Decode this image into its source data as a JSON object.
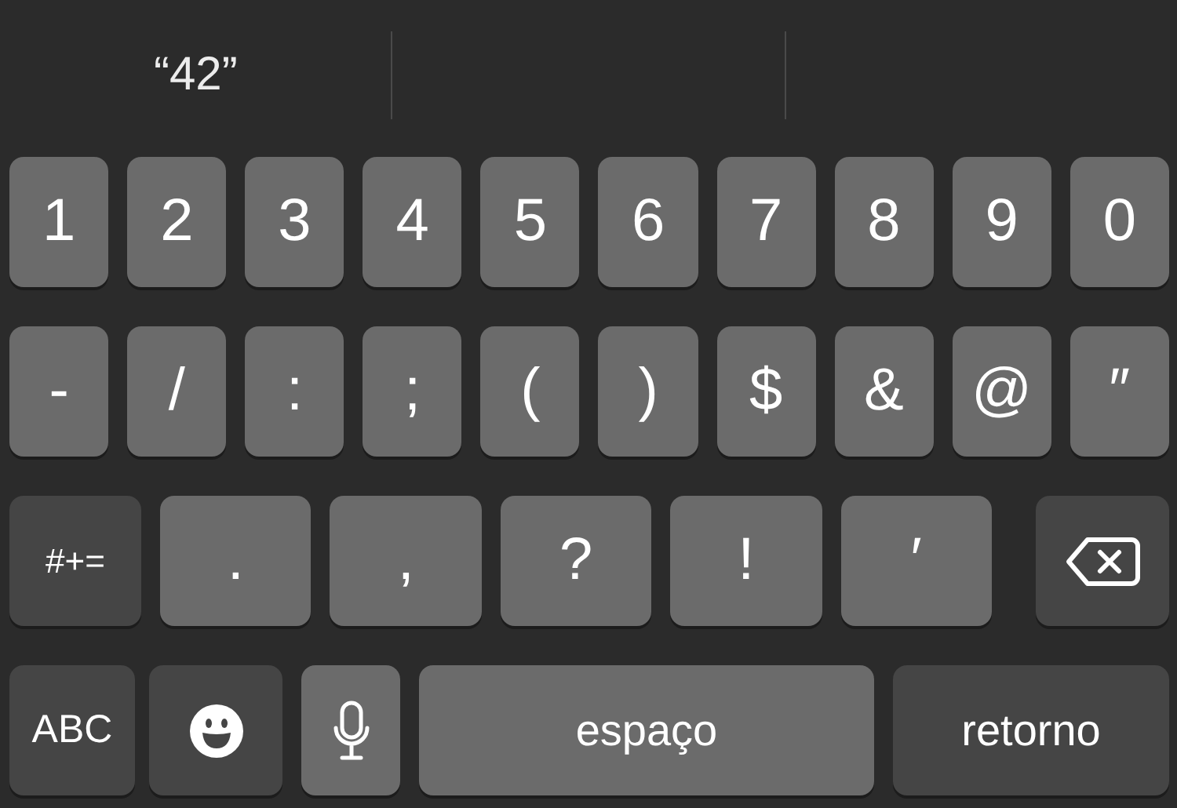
{
  "suggestions": [
    "“42”"
  ],
  "rows": [
    {
      "keys": [
        {
          "kind": "char",
          "label": "1"
        },
        {
          "kind": "char",
          "label": "2"
        },
        {
          "kind": "char",
          "label": "3"
        },
        {
          "kind": "char",
          "label": "4"
        },
        {
          "kind": "char",
          "label": "5"
        },
        {
          "kind": "char",
          "label": "6"
        },
        {
          "kind": "char",
          "label": "7"
        },
        {
          "kind": "char",
          "label": "8"
        },
        {
          "kind": "char",
          "label": "9"
        },
        {
          "kind": "char",
          "label": "0"
        }
      ]
    },
    {
      "keys": [
        {
          "kind": "char",
          "label": "-"
        },
        {
          "kind": "char",
          "label": "/"
        },
        {
          "kind": "char",
          "label": ":"
        },
        {
          "kind": "char",
          "label": ";"
        },
        {
          "kind": "char",
          "label": "("
        },
        {
          "kind": "char",
          "label": ")"
        },
        {
          "kind": "char",
          "label": "$"
        },
        {
          "kind": "char",
          "label": "&"
        },
        {
          "kind": "char",
          "label": "@"
        },
        {
          "kind": "char",
          "label": "″"
        }
      ]
    },
    {
      "keys": [
        {
          "kind": "function",
          "label": "#+="
        },
        {
          "kind": "wide",
          "label": "."
        },
        {
          "kind": "wide",
          "label": ","
        },
        {
          "kind": "wide",
          "label": "?"
        },
        {
          "kind": "wide",
          "label": "!"
        },
        {
          "kind": "wide",
          "label": "′"
        },
        {
          "kind": "backspace"
        }
      ]
    },
    {
      "keys": [
        {
          "kind": "function",
          "label": "ABC"
        },
        {
          "kind": "emoji"
        },
        {
          "kind": "mic"
        },
        {
          "kind": "space",
          "label": "espaço"
        },
        {
          "kind": "return",
          "label": "retorno"
        }
      ]
    }
  ]
}
